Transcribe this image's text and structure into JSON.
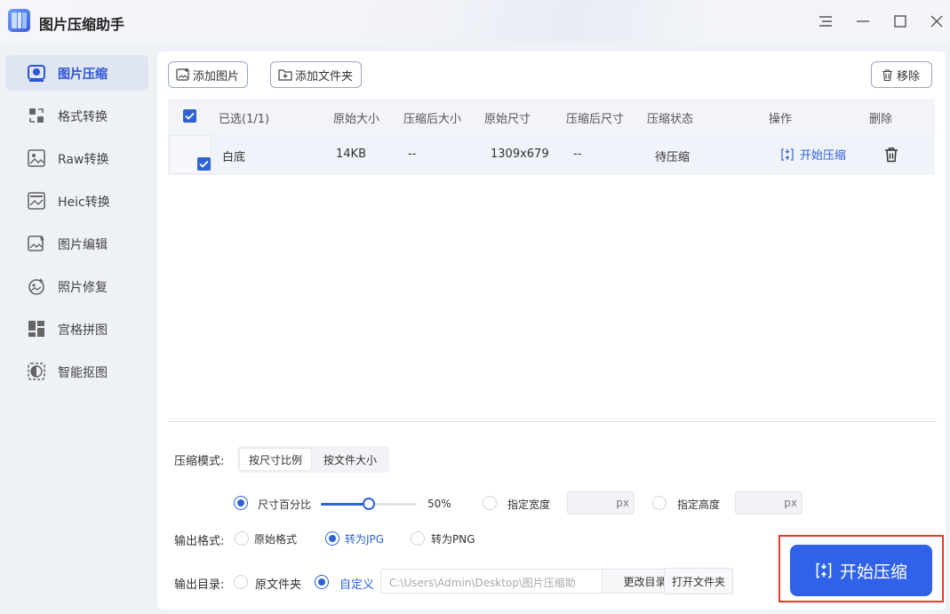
{
  "app": {
    "title": "图片压缩助手"
  },
  "window_controls": [
    "menu-icon",
    "minimize-icon",
    "maximize-icon",
    "close-icon"
  ],
  "sidebar": {
    "items": [
      {
        "label": "图片压缩",
        "icon": "image-compress-icon",
        "active": true
      },
      {
        "label": "格式转换",
        "icon": "format-convert-icon",
        "active": false
      },
      {
        "label": "Raw转换",
        "icon": "raw-convert-icon",
        "active": false
      },
      {
        "label": "Heic转换",
        "icon": "heic-convert-icon",
        "active": false
      },
      {
        "label": "图片编辑",
        "icon": "image-edit-icon",
        "active": false
      },
      {
        "label": "照片修复",
        "icon": "photo-repair-icon",
        "active": false
      },
      {
        "label": "宫格拼图",
        "icon": "grid-collage-icon",
        "active": false
      },
      {
        "label": "智能抠图",
        "icon": "smart-cutout-icon",
        "active": false
      }
    ]
  },
  "toolbar": {
    "add_image": "添加图片",
    "add_folder": "添加文件夹",
    "remove": "移除"
  },
  "table": {
    "headers": {
      "selected": "已选(1/1)",
      "orig_size": "原始大小",
      "comp_size": "压缩后大小",
      "orig_dim": "原始尺寸",
      "comp_dim": "压缩后尺寸",
      "status": "压缩状态",
      "action": "操作",
      "delete": "删除"
    },
    "rows": [
      {
        "checked": true,
        "name": "白底",
        "orig_size": "14KB",
        "comp_size": "--",
        "orig_dim": "1309x679",
        "comp_dim": "--",
        "status": "待压缩",
        "action": "开始压缩"
      }
    ]
  },
  "settings": {
    "mode_label": "压缩模式:",
    "mode_options": [
      "按尺寸比例",
      "按文件大小"
    ],
    "mode_selected": "按尺寸比例",
    "percent_label": "尺寸百分比",
    "percent_value": "50%",
    "percent_fraction": 0.5,
    "width_label": "指定宽度",
    "width_unit": "px",
    "height_label": "指定高度",
    "height_unit": "px",
    "format_label": "输出格式:",
    "format_options": [
      "原始格式",
      "转为JPG",
      "转为PNG"
    ],
    "format_selected": "转为JPG",
    "dir_label": "输出目录:",
    "dir_options": [
      "原文件夹",
      "自定义"
    ],
    "dir_selected": "自定义",
    "dir_path": "C:\\Users\\Admin\\Desktop\\图片压缩助",
    "change_dir": "更改目录",
    "open_folder": "打开文件夹"
  },
  "start_button": "开始压缩",
  "colors": {
    "accent": "#2f62e8",
    "highlight_frame": "#e4392c"
  }
}
